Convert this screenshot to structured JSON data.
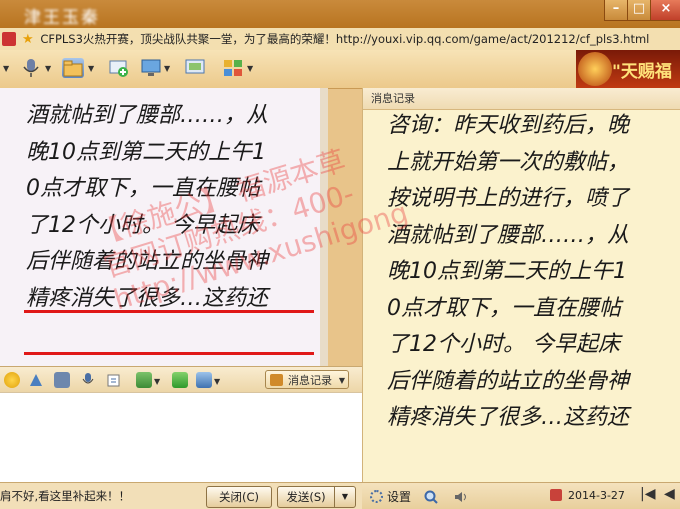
{
  "window": {
    "title": "津王玉秦",
    "announcement": "CFPLS3火热开赛，顶尖战队共聚一堂，为了最高的荣耀！http://youxi.vip.qq.com/game/act/201212/cf_pls3.html"
  },
  "ad": {
    "text": "\"天赐福"
  },
  "chat": {
    "lines": [
      "酒就帖到了腰部……，从",
      "晚10点到第二天的上午1",
      "0点才取下，一直在腰帖",
      "了12个小时。  今早起床",
      "后伴随着的站立的坐骨神",
      "精疼消失了很多…这药还"
    ]
  },
  "input_toolbar": {
    "message_record_label": "消息记录"
  },
  "bottom": {
    "tip": "肩不好,看这里补起来！！",
    "close_label": "关闭(C)",
    "send_label": "发送(S)"
  },
  "record": {
    "header": "消息记录",
    "lines": [
      "咨询：昨天收到药后，晚",
      "上就开始第一次的敷帖，",
      "按说明书上的进行，喷了",
      "酒就帖到了腰部……，从",
      "晚10点到第二天的上午1",
      "0点才取下，一直在腰帖",
      "了12个小时。  今早起床",
      "后伴随着的站立的坐骨神",
      "精疼消失了很多…这药还"
    ],
    "settings_label": "设置",
    "date": "2014-3-27"
  },
  "watermark": {
    "line1": "【徐施公】  福源本草 ",
    "line2": "官网订购热线：400-",
    "line3": "http://www.xushigong"
  },
  "colors": {
    "underline": "#e01818",
    "titlebar": "#c98a3c",
    "record_bg": "#fbf2cd"
  }
}
